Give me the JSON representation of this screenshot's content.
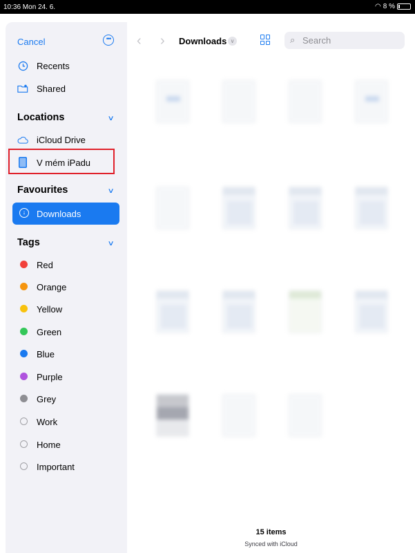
{
  "status_bar": {
    "time": "10:36  Mon 24. 6.",
    "battery": "8 %"
  },
  "sidebar": {
    "cancel": "Cancel",
    "top_items": [
      {
        "label": "Recents",
        "icon": "clock-icon"
      },
      {
        "label": "Shared",
        "icon": "shared-folder-icon"
      }
    ],
    "locations": {
      "title": "Locations",
      "items": [
        {
          "label": "iCloud Drive",
          "icon": "cloud-icon"
        },
        {
          "label": "V mém iPadu",
          "icon": "ipad-icon"
        }
      ]
    },
    "favourites": {
      "title": "Favourites",
      "items": [
        {
          "label": "Downloads",
          "icon": "download-icon"
        }
      ]
    },
    "tags": {
      "title": "Tags",
      "items": [
        {
          "label": "Red",
          "color": "#f2403a"
        },
        {
          "label": "Orange",
          "color": "#f6950e"
        },
        {
          "label": "Yellow",
          "color": "#f8c20e"
        },
        {
          "label": "Green",
          "color": "#34c759"
        },
        {
          "label": "Blue",
          "color": "#1a7af0"
        },
        {
          "label": "Purple",
          "color": "#af52de"
        },
        {
          "label": "Grey",
          "color": "#8e8e93"
        },
        {
          "label": "Work",
          "color": ""
        },
        {
          "label": "Home",
          "color": ""
        },
        {
          "label": "Important",
          "color": ""
        }
      ]
    }
  },
  "toolbar": {
    "location_title": "Downloads",
    "search_placeholder": "Search"
  },
  "footer": {
    "item_count": "15 items",
    "sync_status": "Synced with iCloud"
  },
  "colors": {
    "accent": "#1a7af0",
    "highlight_box": "#e0202a",
    "sidebar_bg": "#f2f2f7"
  }
}
